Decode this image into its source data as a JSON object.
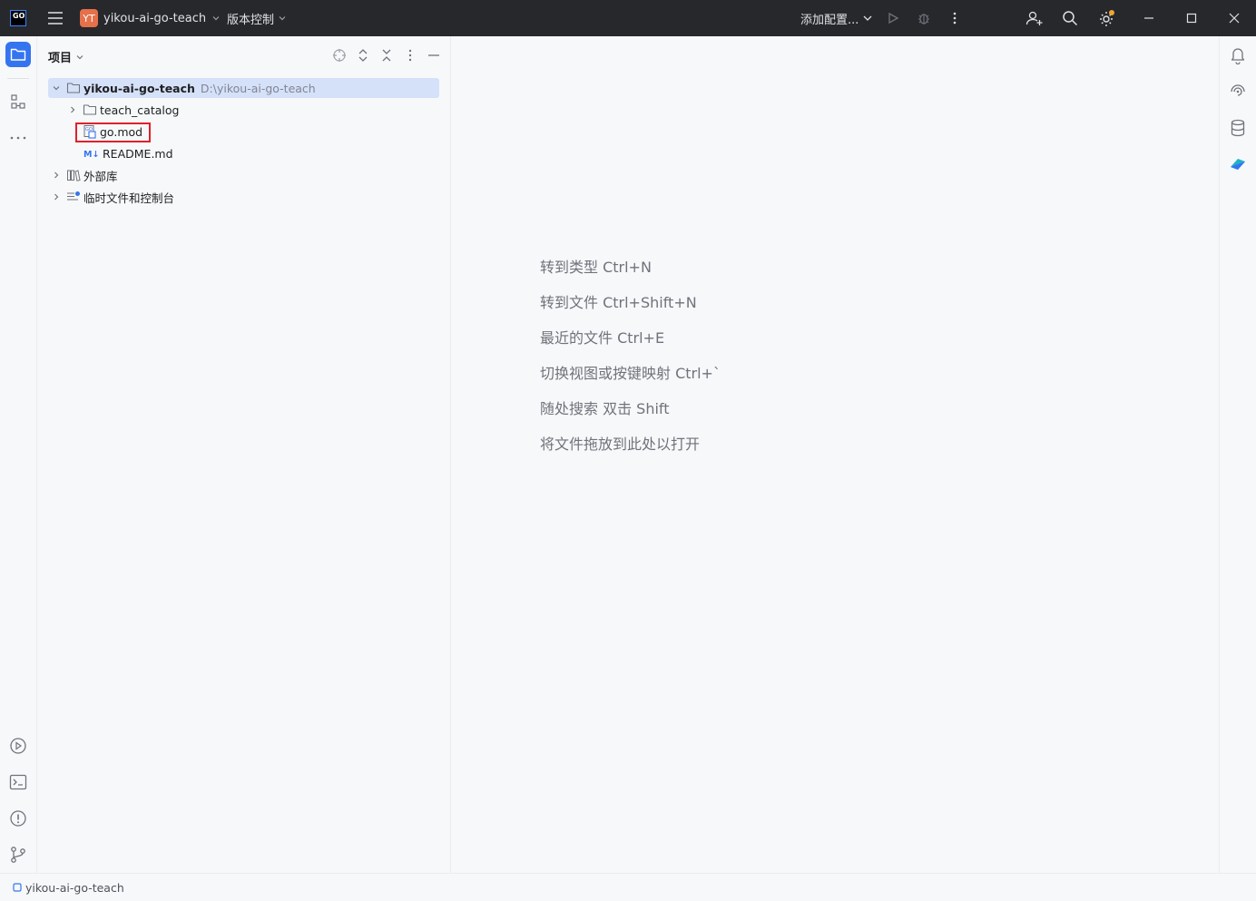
{
  "titlebar": {
    "logo_text": "GO",
    "project_badge": "YT",
    "project_name": "yikou-ai-go-teach",
    "vcs_label": "版本控制",
    "run_config_label": "添加配置..."
  },
  "project_panel": {
    "title": "项目",
    "tree": [
      {
        "label": "yikou-ai-go-teach",
        "path": "D:\\yikou-ai-go-teach"
      },
      {
        "label": "teach_catalog"
      },
      {
        "label": "go.mod"
      },
      {
        "label": "README.md"
      },
      {
        "label": "外部库"
      },
      {
        "label": "临时文件和控制台"
      }
    ]
  },
  "editor_hints": [
    "转到类型 Ctrl+N",
    "转到文件 Ctrl+Shift+N",
    "最近的文件 Ctrl+E",
    "切换视图或按键映射 Ctrl+`",
    "随处搜索 双击 Shift",
    "将文件拖放到此处以打开"
  ],
  "statusbar": {
    "project_path": "yikou-ai-go-teach"
  },
  "colors": {
    "titlebar_bg": "#27282c",
    "accent": "#3574f0",
    "selection": "#d5e1f9",
    "highlight_box": "#e0202a",
    "project_badge": "#e5704a"
  }
}
